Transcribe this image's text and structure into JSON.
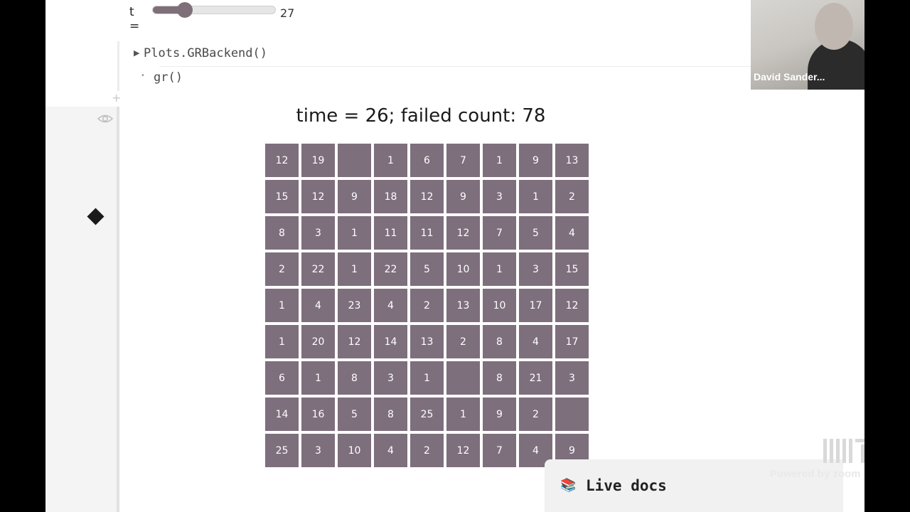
{
  "slider": {
    "label": "t =",
    "value": "27",
    "fraction": 0.26
  },
  "code_cell": {
    "output_line": "Plots.GRBackend()",
    "input_line": "gr()"
  },
  "plot": {
    "title": "time = 26;  failed count: 78",
    "cell_color": "#7e6f7d"
  },
  "chart_data": {
    "type": "heatmap",
    "title": "time = 26;  failed count: 78",
    "rows": 9,
    "cols": 9,
    "values": [
      [
        "12",
        "19",
        "",
        "1",
        "6",
        "7",
        "1",
        "9",
        "13"
      ],
      [
        "15",
        "12",
        "9",
        "18",
        "12",
        "9",
        "3",
        "1",
        "2"
      ],
      [
        "8",
        "3",
        "1",
        "11",
        "11",
        "12",
        "7",
        "5",
        "4"
      ],
      [
        "2",
        "22",
        "1",
        "22",
        "5",
        "10",
        "1",
        "3",
        "15"
      ],
      [
        "1",
        "4",
        "23",
        "4",
        "2",
        "13",
        "10",
        "17",
        "12"
      ],
      [
        "1",
        "20",
        "12",
        "14",
        "13",
        "2",
        "8",
        "4",
        "17"
      ],
      [
        "6",
        "1",
        "8",
        "3",
        "1",
        "",
        "8",
        "21",
        "3"
      ],
      [
        "14",
        "16",
        "5",
        "8",
        "25",
        "1",
        "9",
        "2",
        ""
      ],
      [
        "25",
        "3",
        "10",
        "4",
        "2",
        "12",
        "7",
        "4",
        "9"
      ]
    ]
  },
  "video": {
    "participant_name": "David Sander..."
  },
  "watermark": {
    "text": "Powered by zoom"
  },
  "live_docs": {
    "label": "Live docs"
  },
  "icons": {
    "eye": "eye-icon",
    "diamond": "diamond-icon",
    "plus": "plus-icon",
    "book": "book-icon"
  }
}
